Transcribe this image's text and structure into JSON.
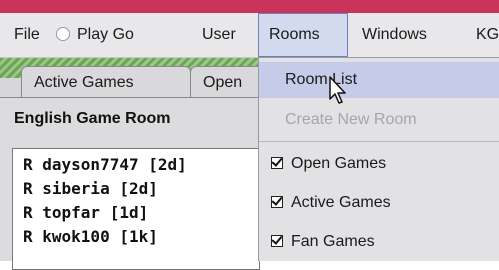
{
  "menubar": {
    "file": "File",
    "play_go": "Play Go",
    "user": "User",
    "rooms": "Rooms",
    "windows": "Windows",
    "kg": "KG"
  },
  "tabs": {
    "active_games": "Active Games",
    "open": "Open"
  },
  "room": {
    "title": "English Game Room",
    "list": [
      "R  dayson7747 [2d]",
      "R  siberia [2d]",
      "R  topfar [1d]",
      "R  kwok100 [1k]"
    ]
  },
  "rooms_menu": {
    "room_list": "Room List",
    "create_new_room": "Create New Room",
    "open_games": "Open Games",
    "active_games": "Active Games",
    "fan_games": "Fan Games"
  },
  "colors": {
    "top_strip": "#c9345a",
    "highlight": "#c6cbe9",
    "hatch_green": "#6ea45a"
  }
}
